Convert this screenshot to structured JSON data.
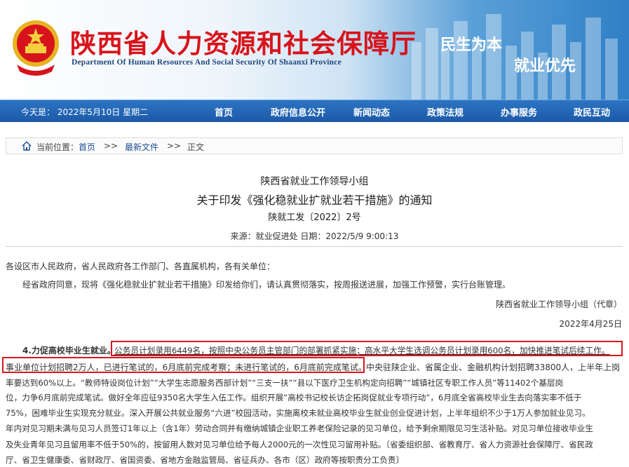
{
  "header": {
    "title": "陕西省人力资源和社会保障厅",
    "subtitle": "Department Of Human Resources And Social Security Of Shaanxi Province",
    "slogan_line1": "民生为本",
    "slogan_line2": "就业优先"
  },
  "nav": {
    "today": "今天是：  2022年5月10日 星期二",
    "items": [
      "首页",
      "政府信息公开",
      "新闻动态",
      "政策法规",
      "办事服务",
      "政民互动"
    ]
  },
  "breadcrumb": {
    "prefix": "当前位置：",
    "items": [
      "首页",
      "最新文件",
      "正文"
    ],
    "separator": ">>"
  },
  "article": {
    "issuer": "陕西省就业工作领导小组",
    "title": "关于印发《强化稳就业扩就业若干措施》的通知",
    "doc_no": "陕就工发〔2022〕2号",
    "meta": "来源：就业促进处    日期：2022/5/9 9:00:13",
    "salutation": "各设区市人民政府，省人民政府各工作部门、各直属机构，各有关单位：",
    "intro": "经省政府同意，现将《强化稳就业扩就业若干措施》印发给你们，请认真贯彻落实，按周报送进展，加强工作预警，实行台账管理。",
    "signature": "陕西省就业工作领导小组（代章）",
    "date": "2022年4月25日",
    "section_title": "4.力促高校毕业生就业。",
    "line1_box": "公务员计划录用6449名，按照中央公务员主管部门的部署抓紧实施；高水平大学生选调公务员计划录用600名，加快推进笔试后续工作。",
    "line2_box": "事业单位计划招聘2万人，已进行笔试的，6月底前完成考察；未进行笔试的，6月底前完成笔试。",
    "line2_rest": "中央驻陕企业、省属企业、金融机构计划招聘33800人，上半年上岗",
    "lines": [
      "率要达到60%以上。“教师特设岗位计划”“大学生志愿服务西部计划”“三支一扶”“县以下医疗卫生机构定向招聘”“城镇社区专职工作人员”等11402个基层岗",
      "位，力争6月底前完成笔试。做好全年应征9350名大学生入伍工作。组织开展“高校书记校长访企拓岗促就业专项行动”，6月底全省高校毕业生去向落实率不低于",
      "75%，困难毕业生实现充分就业。深入开展公共就业服务“六进”校园活动，实施离校未就业高校毕业生就业创业促进计划，上半年组织不少于1万人参加就业见习。",
      "年内对见习期未满与见习人员签订1年以上（含1年）劳动合同并有缴纳城镇企业职工养老保险记录的见习单位，给予剩余期限见习生活补贴。对见习单位接收毕业生",
      "及失业青年见习且留用率不低于50%的，按留用人数对见习单位给予每人2000元的一次性见习留用补贴。〔省委组织部、省教育厅、省人力资源社会保障厅、省民政",
      "厅、省卫生健康委、省财政厅、省国资委、省地方金融监管局、省征兵办、各市（区）政府等按职责分工负责〕"
    ]
  },
  "colors": {
    "title_red": "#d8131b",
    "nav_blue": "#1b5aa9",
    "box_red": "#d7171e"
  }
}
